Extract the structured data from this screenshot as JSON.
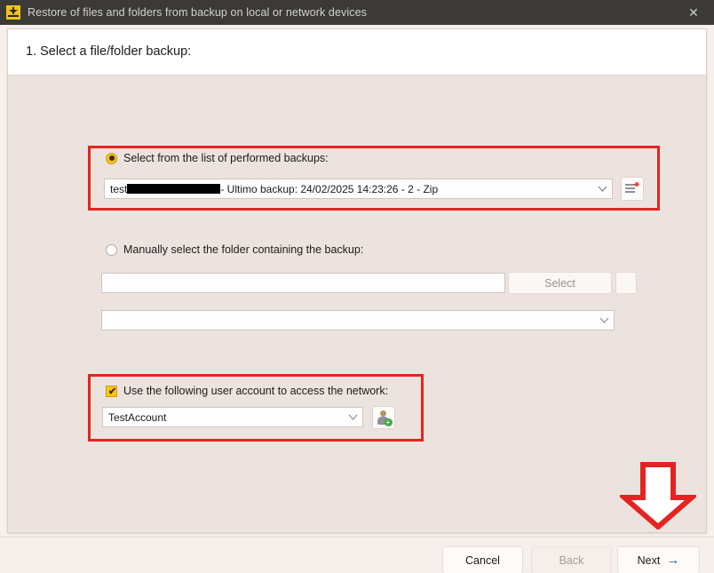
{
  "titlebar": {
    "icon": "anchor-download-icon",
    "title": "Restore of files and folders from backup on local or network devices",
    "close_label": "✕"
  },
  "header": {
    "step_title": "1. Select a file/folder backup:"
  },
  "section_backup_list": {
    "radio_label": "Select from the list of performed backups:",
    "radio_selected": true,
    "combo_prefix": "test",
    "combo_redacted": true,
    "combo_suffix": " - Ultimo backup: 24/02/2025 14:23:26 - 2 - Zip",
    "side_button_icon": "list-details-icon",
    "highlight_color": "#e52421"
  },
  "section_manual_folder": {
    "radio_label": "Manually select the folder containing the backup:",
    "radio_selected": false,
    "path_value": "",
    "select_button_label": "Select",
    "select_button_disabled": true,
    "extra_button_label": "",
    "folder_combo_value": ""
  },
  "section_user_account": {
    "checkbox_label": "Use the following user account to access the network:",
    "checkbox_checked": true,
    "account_value": "TestAccount",
    "side_button_icon": "add-user-icon",
    "highlight_color": "#e52421"
  },
  "annotation": {
    "arrow_icon": "down-arrow-annotation",
    "arrow_color": "#e52421"
  },
  "footer": {
    "cancel_label": "Cancel",
    "back_label": "Back",
    "back_disabled": true,
    "next_label": "Next",
    "next_arrow": "→"
  }
}
